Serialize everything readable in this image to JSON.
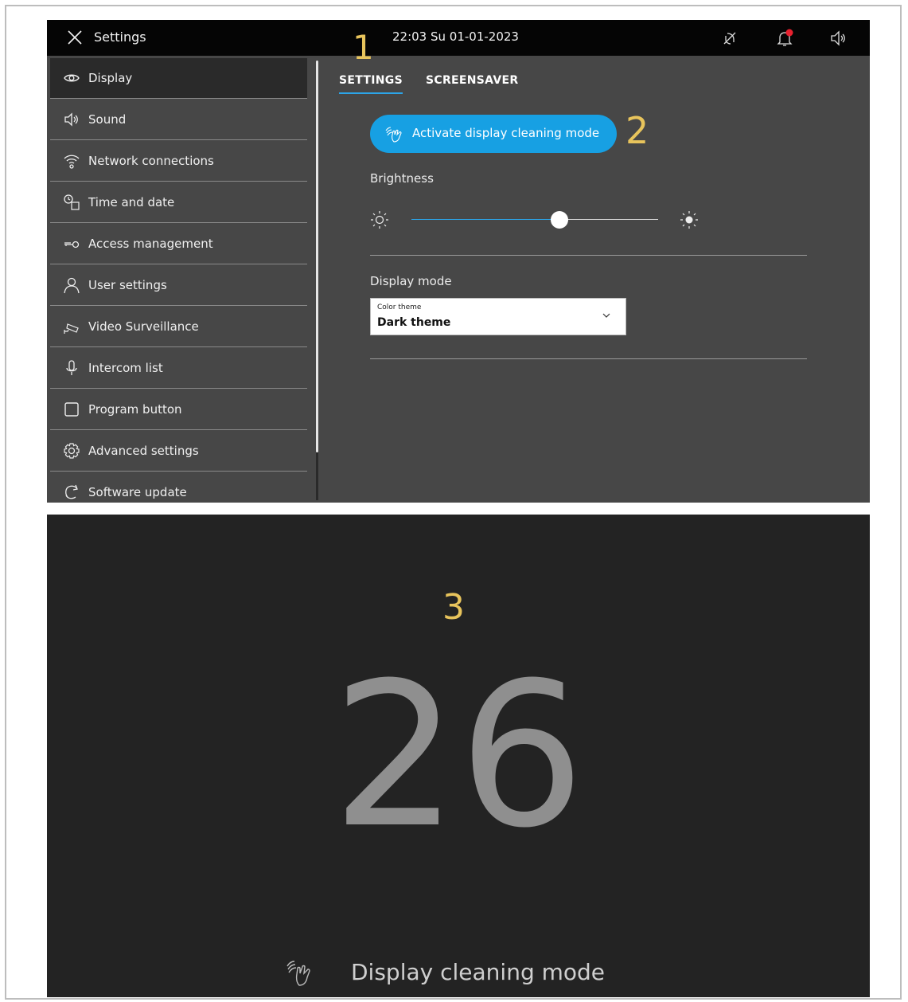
{
  "topbar": {
    "title": "Settings",
    "datetime": "22:03  Su 01-01-2023",
    "icons": [
      "close-icon",
      "mute-icon",
      "bell-icon",
      "speaker-icon"
    ],
    "notification_dot_color": "#e8212f"
  },
  "sidebar": {
    "items": [
      {
        "label": "Display",
        "icon": "eye-icon",
        "active": true
      },
      {
        "label": "Sound",
        "icon": "speaker-icon"
      },
      {
        "label": "Network connections",
        "icon": "wifi-icon"
      },
      {
        "label": "Time and date",
        "icon": "clock-calendar-icon"
      },
      {
        "label": "Access  management",
        "icon": "key-icon"
      },
      {
        "label": "User settings",
        "icon": "user-icon"
      },
      {
        "label": "Video Surveillance",
        "icon": "camera-icon"
      },
      {
        "label": "Intercom list",
        "icon": "microphone-icon"
      },
      {
        "label": "Program button",
        "icon": "square-icon"
      },
      {
        "label": "Advanced settings",
        "icon": "gear-icon"
      },
      {
        "label": "Software update",
        "icon": "refresh-icon"
      }
    ]
  },
  "tabs": [
    {
      "label": "SETTINGS",
      "active": true
    },
    {
      "label": "SCREENSAVER",
      "active": false
    }
  ],
  "steps": {
    "one": "1",
    "two": "2",
    "three": "3"
  },
  "display": {
    "clean_button_label": "Activate display cleaning mode",
    "brightness_label": "Brightness",
    "brightness_level": 0.6,
    "display_mode_label": "Display mode",
    "color_theme_label": "Color theme",
    "color_theme_value": "Dark theme"
  },
  "cleaning": {
    "countdown": "26",
    "label": "Display cleaning mode"
  },
  "colors": {
    "accent": "#17a0e3",
    "step_marker": "#e8c45c",
    "topbar": "#050505",
    "panel": "#474747",
    "cleaning_bg": "#232323"
  }
}
